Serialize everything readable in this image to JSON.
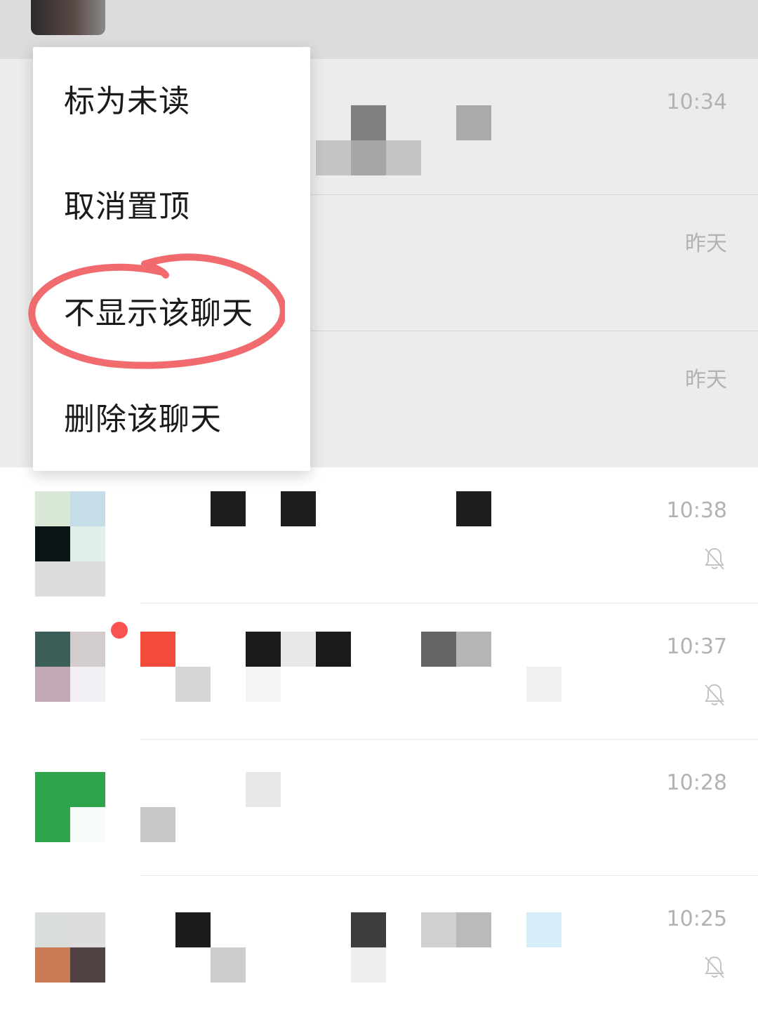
{
  "context_menu": {
    "items": [
      {
        "label": "标为未读"
      },
      {
        "label": "取消置顶"
      },
      {
        "label": "不显示该聊天"
      },
      {
        "label": "删除该聊天"
      }
    ],
    "highlighted_index": 2,
    "annotation_color": "#f06a6e"
  },
  "chats": [
    {
      "time": "10:34",
      "muted": false
    },
    {
      "time": "昨天",
      "muted": false
    },
    {
      "time": "昨天",
      "muted": false
    },
    {
      "time": "10:38",
      "muted": true
    },
    {
      "time": "10:37",
      "muted": true
    },
    {
      "time": "10:28",
      "muted": false
    },
    {
      "time": "10:25",
      "muted": true
    }
  ],
  "icons": {
    "mute": "bell-slash-icon"
  },
  "colors": {
    "unread_badge": "#fa5151",
    "time_text": "#b2b2b2",
    "pinned_bg": "#ececec"
  }
}
